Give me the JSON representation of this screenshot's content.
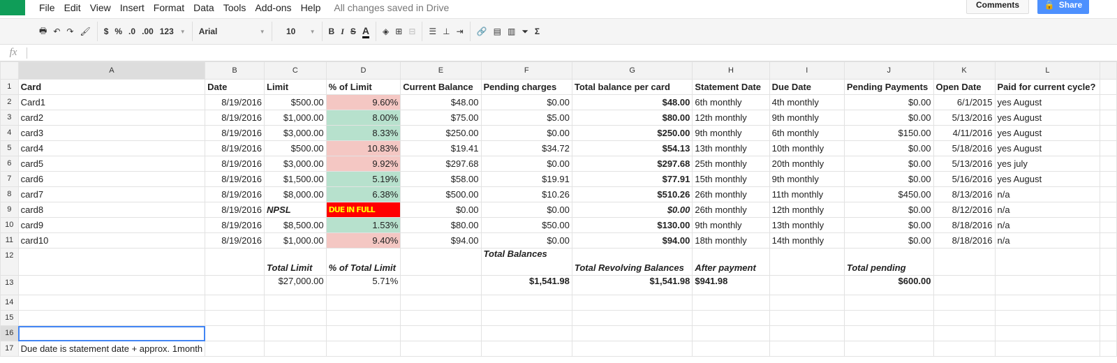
{
  "menu": {
    "items": [
      "File",
      "Edit",
      "View",
      "Insert",
      "Format",
      "Data",
      "Tools",
      "Add-ons",
      "Help"
    ],
    "status": "All changes saved in Drive"
  },
  "header": {
    "comments": "Comments",
    "share": "Share"
  },
  "toolbar": {
    "currency": "$",
    "percent": "%",
    "dec_less": ".0",
    "dec_more": ".00",
    "more_formats": "123",
    "font": "Arial",
    "size": "10",
    "bold": "B",
    "italic": "I",
    "strike": "S",
    "text_color": "A",
    "sum": "Σ"
  },
  "formula_bar": {
    "fx": "fx",
    "value": ""
  },
  "columns": [
    "A",
    "B",
    "C",
    "D",
    "E",
    "F",
    "G",
    "H",
    "I",
    "J",
    "K",
    "L"
  ],
  "colors": {
    "red": "#f4c7c3",
    "green": "#b7e1cd",
    "due": "#ff0000"
  },
  "rows": [
    {
      "n": "1",
      "cells": [
        "Card",
        "Date",
        "Limit",
        "% of Limit",
        "Current Balance",
        "Pending charges",
        "Total balance per card",
        "Statement Date",
        "Due Date",
        "Pending Payments",
        "Open Date",
        "Paid for current cycle?"
      ]
    },
    {
      "n": "2",
      "hl": "red",
      "cells": [
        "Card1",
        "8/19/2016",
        "$500.00",
        "9.60%",
        "$48.00",
        "$0.00",
        "$48.00",
        "6th monthly",
        "4th monthly",
        "$0.00",
        "6/1/2015",
        "yes August"
      ]
    },
    {
      "n": "3",
      "hl": "green",
      "cells": [
        "card2",
        "8/19/2016",
        "$1,000.00",
        "8.00%",
        "$75.00",
        "$5.00",
        "$80.00",
        "12th monthly",
        "9th monthly",
        "$0.00",
        "5/13/2016",
        "yes August"
      ]
    },
    {
      "n": "4",
      "hl": "green",
      "cells": [
        "card3",
        "8/19/2016",
        "$3,000.00",
        "8.33%",
        "$250.00",
        "$0.00",
        "$250.00",
        "9th monthly",
        "6th monthly",
        "$150.00",
        "4/11/2016",
        "yes August"
      ]
    },
    {
      "n": "5",
      "hl": "red",
      "cells": [
        "card4",
        "8/19/2016",
        "$500.00",
        "10.83%",
        "$19.41",
        "$34.72",
        "$54.13",
        "13th monthly",
        "10th monthly",
        "$0.00",
        "5/18/2016",
        "yes August"
      ]
    },
    {
      "n": "6",
      "hl": "red",
      "cells": [
        "card5",
        "8/19/2016",
        "$3,000.00",
        "9.92%",
        "$297.68",
        "$0.00",
        "$297.68",
        "25th monthly",
        "20th monthly",
        "$0.00",
        "5/13/2016",
        "yes july"
      ]
    },
    {
      "n": "7",
      "hl": "green",
      "cells": [
        "card6",
        "8/19/2016",
        "$1,500.00",
        "5.19%",
        "$58.00",
        "$19.91",
        "$77.91",
        "15th monthly",
        "9th monthly",
        "$0.00",
        "5/16/2016",
        "yes August"
      ]
    },
    {
      "n": "8",
      "hl": "green",
      "cells": [
        "card7",
        "8/19/2016",
        "$8,000.00",
        "6.38%",
        "$500.00",
        "$10.26",
        "$510.26",
        "26th monthly",
        "11th monthly",
        "$450.00",
        "8/13/2016",
        "n/a"
      ]
    },
    {
      "n": "9",
      "hl": "due",
      "cells": [
        "card8",
        "8/19/2016",
        "NPSL",
        "DUE IN FULL",
        "$0.00",
        "$0.00",
        "$0.00",
        "26th monthly",
        "12th monthly",
        "$0.00",
        "8/12/2016",
        "n/a"
      ]
    },
    {
      "n": "10",
      "hl": "green",
      "cells": [
        "card9",
        "8/19/2016",
        "$8,500.00",
        "1.53%",
        "$80.00",
        "$50.00",
        "$130.00",
        "9th monthly",
        "13th monthly",
        "$0.00",
        "8/18/2016",
        "n/a"
      ]
    },
    {
      "n": "11",
      "hl": "red",
      "cells": [
        "card10",
        "8/19/2016",
        "$1,000.00",
        "9.40%",
        "$94.00",
        "$0.00",
        "$94.00",
        "18th monthly",
        "14th monthly",
        "$0.00",
        "8/18/2016",
        "n/a"
      ]
    },
    {
      "n": "12",
      "cells": [
        "",
        "",
        "Total Limit",
        "% of Total Limit",
        "",
        "Total Balances",
        "Total Revolving Balances",
        "After payment",
        "",
        "Total pending",
        "",
        ""
      ]
    },
    {
      "n": "13",
      "cells": [
        "",
        "",
        "$27,000.00",
        "5.71%",
        "",
        "$1,541.98",
        "$1,541.98",
        "$941.98",
        "",
        "$600.00",
        "",
        ""
      ]
    },
    {
      "n": "14",
      "cells": [
        "",
        "",
        "",
        "",
        "",
        "",
        "",
        "",
        "",
        "",
        "",
        ""
      ]
    },
    {
      "n": "15",
      "cells": [
        "",
        "",
        "",
        "",
        "",
        "",
        "",
        "",
        "",
        "",
        "",
        ""
      ]
    },
    {
      "n": "16",
      "cells": [
        "",
        "",
        "",
        "",
        "",
        "",
        "",
        "",
        "",
        "",
        "",
        ""
      ]
    },
    {
      "n": "17",
      "cells": [
        "Due date is statement date + approx. 1month",
        "",
        "",
        "",
        "",
        "",
        "",
        "",
        "",
        "",
        "",
        ""
      ]
    }
  ]
}
